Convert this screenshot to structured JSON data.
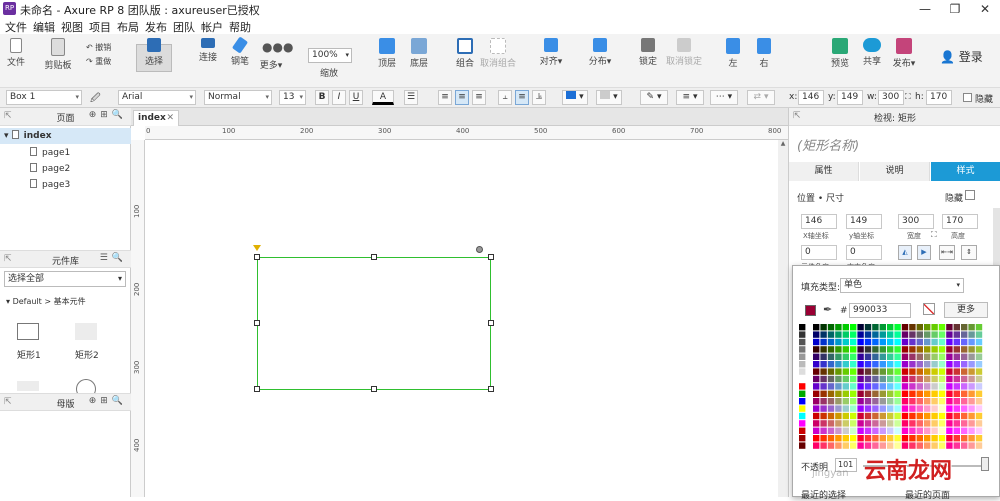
{
  "window": {
    "title": "未命名 - Axure RP 8 团队版 : axureuser已授权",
    "app_icon_text": "RP",
    "controls": [
      "—",
      "❐",
      "✕"
    ]
  },
  "menu": [
    "文件",
    "编辑",
    "视图",
    "项目",
    "布局",
    "发布",
    "团队",
    "帐户",
    "帮助"
  ],
  "toolbar": {
    "file": "文件",
    "clipboard": "剪贴板",
    "undo": "撤销",
    "redo": "重做",
    "select": "选择",
    "connect": "连接",
    "pen": "钢笔",
    "more": "更多▾",
    "zoom_value": "100%",
    "zoom_label": "缩放",
    "top": "顶层",
    "bottom": "底层",
    "group": "组合",
    "ungroup": "取消组合",
    "align": "对齐▾",
    "distribute": "分布▾",
    "lock": "锁定",
    "unlock": "取消锁定",
    "left": "左",
    "right": "右",
    "preview": "预览",
    "share": "共享",
    "publish": "发布▾",
    "login": "登录"
  },
  "format": {
    "widget_name": "Box 1",
    "font_family": "Arial",
    "font_style": "Normal",
    "font_size": "13",
    "bold": "B",
    "italic": "I",
    "underline": "U",
    "font_color": "A",
    "x_label": "x:",
    "x": "146",
    "y_label": "y:",
    "y": "149",
    "w_label": "w:",
    "w": "300",
    "h_label": "h:",
    "h": "170",
    "hide_label": "隐藏"
  },
  "pages_panel": {
    "title": "页面",
    "items": [
      "index",
      "page1",
      "page2",
      "page3"
    ]
  },
  "library_panel": {
    "title": "元件库",
    "select_all": "选择全部",
    "group": "Default > 基本元件",
    "widgets": [
      "矩形1",
      "矩形2"
    ]
  },
  "masters_panel": {
    "title": "母版"
  },
  "canvas": {
    "tab": "index",
    "tab_close": "✕",
    "hruler": [
      "0",
      "100",
      "200",
      "300",
      "400",
      "500",
      "600",
      "700",
      "800"
    ],
    "vruler": [
      "100",
      "200",
      "300",
      "400"
    ]
  },
  "inspector": {
    "header": "检视: 矩形",
    "shape_name": "(矩形名称)",
    "tabs": [
      "属性",
      "说明",
      "样式"
    ],
    "section": "位置 • 尺寸",
    "hide": "隐藏",
    "x": "146",
    "y": "149",
    "w": "300",
    "h": "170",
    "x_label": "X轴坐标",
    "y_label": "y轴坐标",
    "w_label": "宽度",
    "h_label": "高度",
    "rot1": "0",
    "rot2": "0",
    "rot1_label": "元件角度",
    "rot2_label": "文本角度"
  },
  "color_picker": {
    "fill_type_label": "填充类型:",
    "fill_type": "单色",
    "hash": "#",
    "hex": "990033",
    "more": "更多",
    "opacity_label": "不透明",
    "opacity": "101",
    "recent": "最近的选择",
    "recent_page": "最近的页面",
    "current_color": "#990033"
  },
  "watermark": "云南龙网",
  "watermark_sub": "jingyan",
  "colors": {
    "accent": "#1c9ad6",
    "selection": "#2fbf2f",
    "handle": "#333333"
  }
}
